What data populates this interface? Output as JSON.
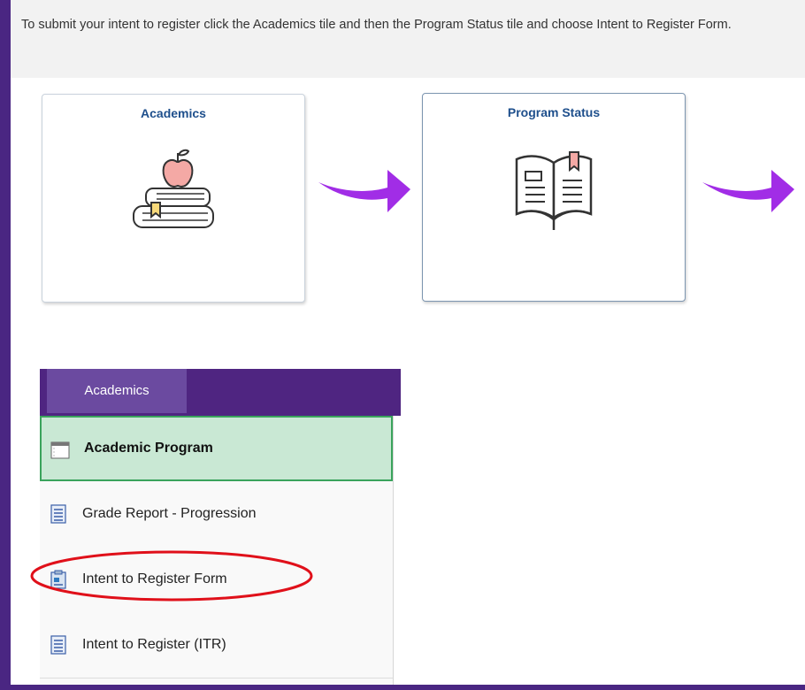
{
  "instruction": "To submit your intent to register click the Academics tile and then the Program Status tile and choose Intent to Register Form.",
  "tiles": [
    {
      "title": "Academics",
      "icon": "books-apple-icon"
    },
    {
      "title": "Program Status",
      "icon": "open-book-icon"
    }
  ],
  "menu": {
    "tab_label": "Academics",
    "items": [
      {
        "label": "Academic Program",
        "icon": "page-icon",
        "active": true
      },
      {
        "label": "Grade Report - Progression",
        "icon": "document-icon"
      },
      {
        "label": "Intent to Register Form",
        "icon": "form-icon",
        "highlighted": true
      },
      {
        "label": "Intent to Register (ITR)",
        "icon": "document-icon"
      }
    ]
  },
  "colors": {
    "background": "#4a2682",
    "arrow": "#a12de6",
    "tile_title": "#1e4f8c",
    "active_item": "#c9e8d4",
    "highlight_ellipse": "#e0101a"
  }
}
